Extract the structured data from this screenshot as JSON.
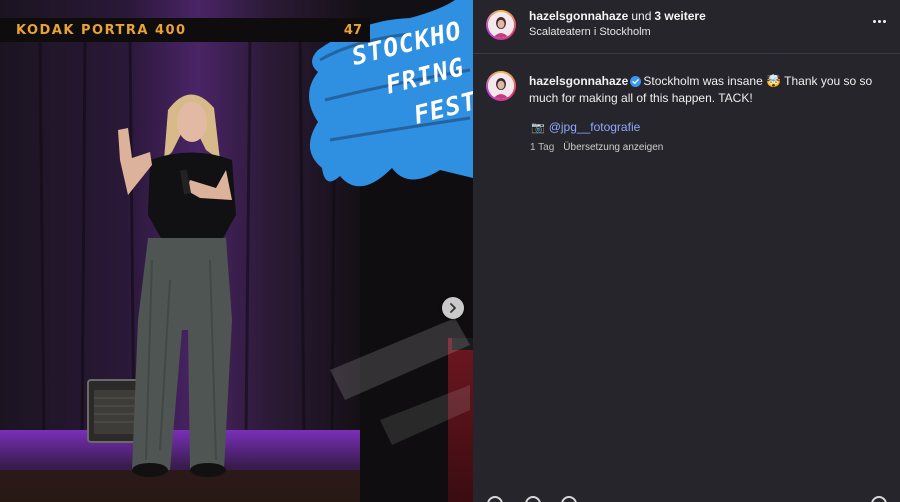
{
  "media": {
    "film_brand": "KODAK PORTRA 400",
    "film_frame_number": "47",
    "sticker_lines": [
      "STOCKHO",
      "FRING",
      "FESTI"
    ],
    "next_label": "Next"
  },
  "post": {
    "header": {
      "username": "hazelsgonnahaze",
      "join_word": "und",
      "others": "3 weitere",
      "location": "Scalateatern i Stockholm"
    },
    "caption": {
      "username": "hazelsgonnahaze",
      "text": "Stockholm was insane 🤯 Thank you so so much for making all of this happen. TACK!",
      "camera_icon": "📷",
      "credit_handle": "@jpg__fotografie"
    },
    "meta": {
      "age": "1 Tag",
      "translate": "Übersetzung anzeigen"
    }
  },
  "colors": {
    "panel_bg": "#25252b",
    "link": "#8fa8ff",
    "verified": "#3897f0",
    "film_text": "#e8a23a",
    "sticker_blue": "#2f8fe0"
  }
}
